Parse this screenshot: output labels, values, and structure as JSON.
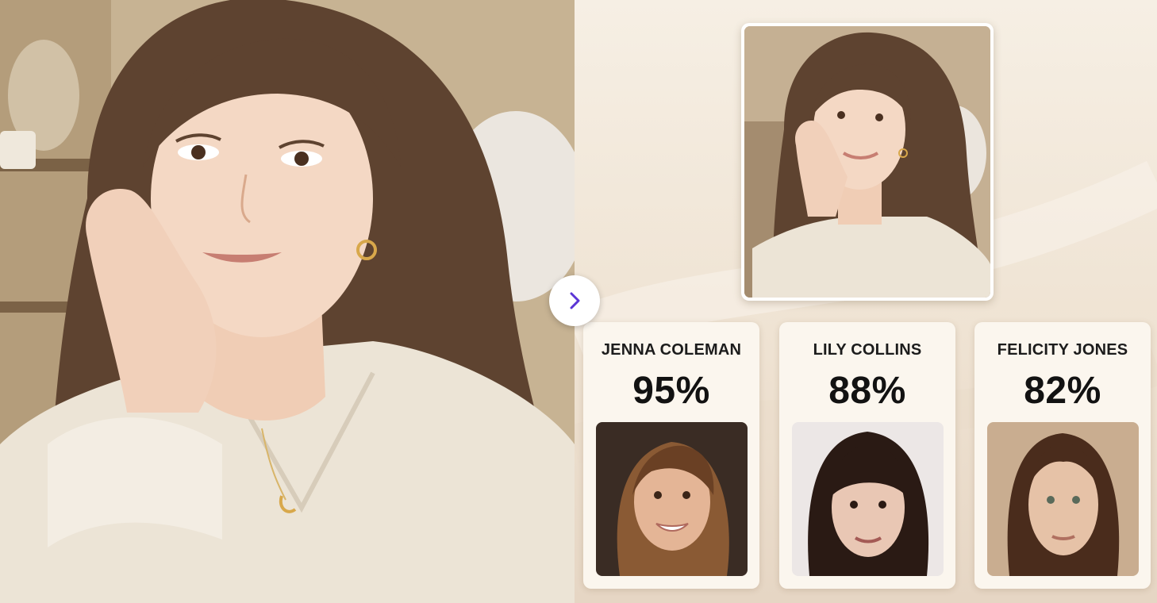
{
  "left": {
    "photo_alt": ""
  },
  "next_button": {
    "icon": "chevron-right-icon",
    "color": "#5b35d5"
  },
  "source_thumbnail": {
    "icon": "portrait"
  },
  "matches": [
    {
      "name": "JENNA COLEMAN",
      "score": "95%",
      "bg": "#3a2c24",
      "hair": "#5a3520",
      "skin": "#e4b596"
    },
    {
      "name": "LILY COLLINS",
      "score": "88%",
      "bg": "#ece7e6",
      "hair": "#2a1a14",
      "skin": "#e9c7b4"
    },
    {
      "name": "FELICITY JONES",
      "score": "82%",
      "bg": "#c9ad90",
      "hair": "#4a2c1c",
      "skin": "#e6c2a7"
    }
  ],
  "colors": {
    "accent": "#5b35d5",
    "card_bg": "#fbf6ee",
    "panel_bg": "#f1e6d8"
  }
}
